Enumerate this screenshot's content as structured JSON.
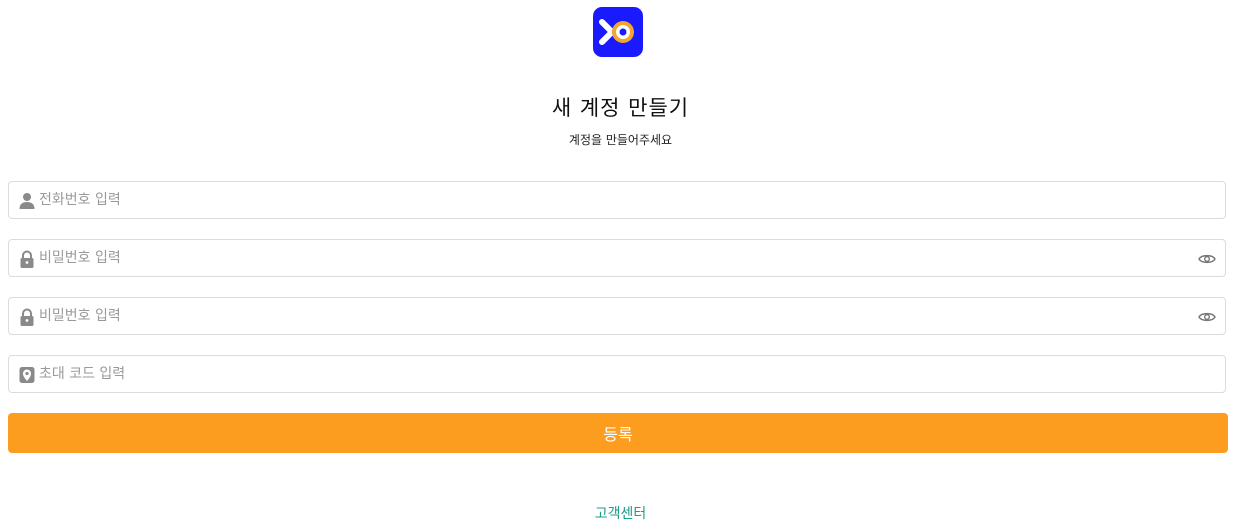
{
  "brand": {
    "logo_icon": "xo-logo-icon",
    "logo_color": "#1a1aff"
  },
  "header": {
    "title": "새 계정 만들기",
    "subtitle": "계정을 만들어주세요"
  },
  "form": {
    "phone": {
      "placeholder": "전화번호 입력",
      "icon": "user-icon"
    },
    "password": {
      "placeholder": "비밀번호 입력",
      "icon": "lock-icon",
      "toggle_icon": "eye-icon"
    },
    "password_confirm": {
      "placeholder": "비밀번호 입력",
      "icon": "lock-icon",
      "toggle_icon": "eye-icon"
    },
    "invite_code": {
      "placeholder": "초대 코드 입력",
      "icon": "location-pin-icon"
    },
    "submit_label": "등록",
    "submit_color": "#fd9d1f"
  },
  "footer": {
    "support_link": "고객센터",
    "support_color": "#1c9d8a"
  }
}
